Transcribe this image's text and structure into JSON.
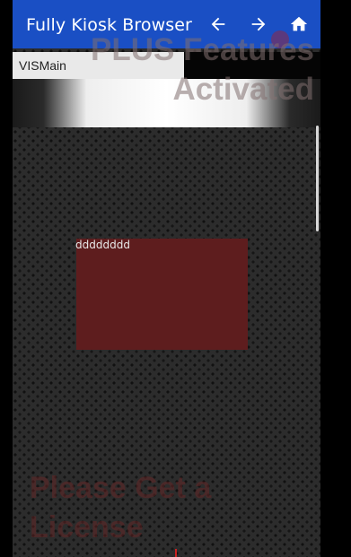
{
  "appbar": {
    "title": "Fully Kiosk Browser",
    "background": "#1a4fc4",
    "buttons": [
      {
        "icon": "arrow-left-icon"
      },
      {
        "icon": "arrow-right-icon"
      },
      {
        "icon": "home-icon"
      }
    ]
  },
  "page": {
    "tab_label": "VISMain",
    "widget": {
      "label": "dddddddd",
      "color": "#5e1d1e"
    }
  },
  "overlays": {
    "plus_features": "PLUS Features Activated",
    "license": "Please Get a License"
  }
}
